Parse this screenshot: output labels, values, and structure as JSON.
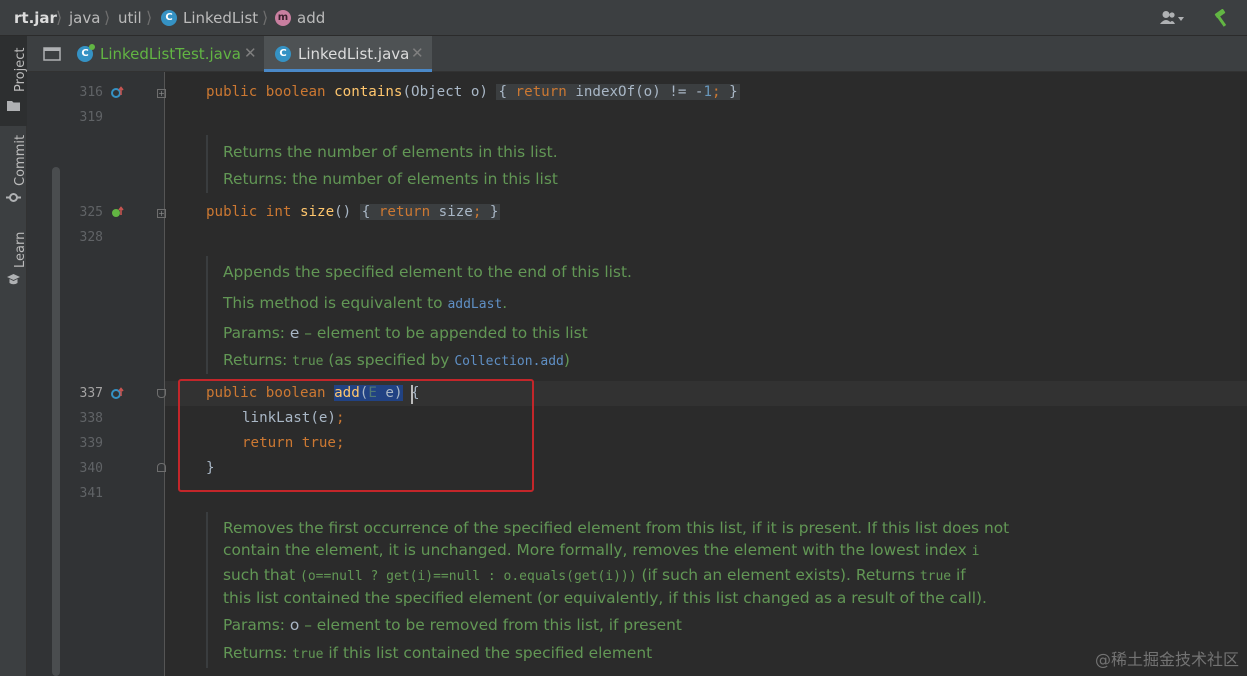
{
  "breadcrumb": {
    "items": [
      "rt.jar",
      "java",
      "util",
      "LinkedList",
      "add"
    ],
    "class_badge": "C",
    "method_badge": "m"
  },
  "sidebar": {
    "items": [
      "Project",
      "Commit",
      "Learn"
    ]
  },
  "tabs": [
    {
      "label": "LinkedListTest.java",
      "icon": "class-icon",
      "active": false,
      "color": "#62b543"
    },
    {
      "label": "LinkedList.java",
      "icon": "class-icon",
      "active": true,
      "color": "#dcdcdc"
    }
  ],
  "tab_badge": "C",
  "lines": {
    "l316": "316",
    "l319": "319",
    "l325": "325",
    "l328": "328",
    "l337": "337",
    "l338": "338",
    "l339": "339",
    "l340": "340",
    "l341": "341"
  },
  "code": {
    "contains": {
      "kw1": "public boolean",
      "name": "contains",
      "params": "(Object o) ",
      "ob": "{",
      "ret": "return",
      "body": " indexOf(o) != -",
      "num": "1",
      "semi": ";",
      "cb": "}"
    },
    "size": {
      "kw1": "public int",
      "name": "size",
      "params": "() ",
      "ob": "{",
      "ret": "return",
      "body": " size",
      "semi": ";",
      "cb": "}"
    },
    "add": {
      "kw1": "public boolean",
      "name": "add",
      "lp": "(",
      "type": "E",
      "param": " e",
      "rp": ")",
      "ob": " {"
    },
    "add_l2": {
      "call": "linkLast(e)",
      "semi": ";"
    },
    "add_l3": {
      "ret": "return",
      "val": " true",
      "semi": ";"
    },
    "add_l4": "}"
  },
  "docs": {
    "size_1": "Returns the number of elements in this list.",
    "size_2": "Returns: the number of elements in this list",
    "add_1": "Appends the specified element to the end of this list.",
    "add_2a": "This method is equivalent to ",
    "add_2b": "addLast",
    "add_2c": ".",
    "add_3a": "Params: ",
    "add_3b": "e",
    "add_3c": " – element to be appended to this list",
    "add_4a": "Returns: ",
    "add_4b": "true",
    "add_4c": " (as specified by ",
    "add_4d": "Collection.add",
    "add_4e": ")",
    "rm_1": "Removes the first occurrence of the specified element from this list, if it is present. If this list does not",
    "rm_2a": "contain the element, it is unchanged. More formally, removes the element with the lowest index ",
    "rm_2b": "i",
    "rm_3a": "such that ",
    "rm_3b": "(o==null  ?  get(i)==null  :  o.equals(get(i)))",
    "rm_3c": " (if such an element exists). Returns ",
    "rm_3d": "true",
    "rm_3e": " if",
    "rm_4": "this list contained the specified element (or equivalently, if this list changed as a result of the call).",
    "rm_5a": "Params: ",
    "rm_5b": "o",
    "rm_5c": " – element to be removed from this list, if present",
    "rm_6a": "Returns: ",
    "rm_6b": "true",
    "rm_6c": " if this list contained the specified element"
  },
  "watermark": "@稀土掘金技术社区",
  "colors": {
    "keyword": "#cc7832",
    "method": "#ffc66d",
    "doc": "#629755",
    "number": "#6897bb",
    "selection": "#214283",
    "highlight_box": "#c3262a"
  }
}
